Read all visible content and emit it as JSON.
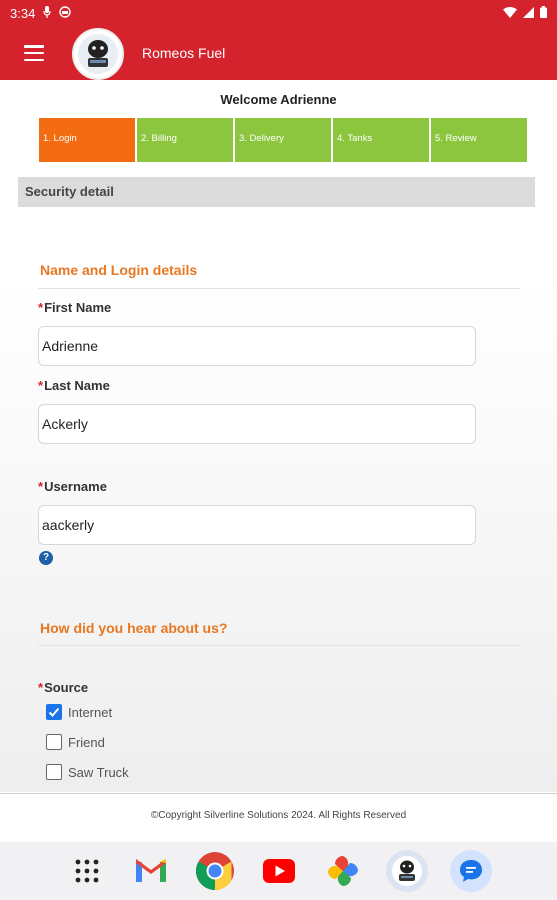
{
  "status_bar": {
    "time": "3:34"
  },
  "app_bar": {
    "title": "Romeos Fuel"
  },
  "welcome": "Welcome Adrienne",
  "steps": [
    {
      "label": "1. Login",
      "active": true
    },
    {
      "label": "2. Billing",
      "active": false
    },
    {
      "label": "3. Delivery",
      "active": false
    },
    {
      "label": "4. Tanks",
      "active": false
    },
    {
      "label": "5. Review",
      "active": false
    }
  ],
  "section_title": "Security detail",
  "login_section": {
    "heading": "Name and Login details",
    "first_name": {
      "label": "First Name",
      "value": "Adrienne"
    },
    "last_name": {
      "label": "Last Name",
      "value": "Ackerly"
    },
    "username": {
      "label": "Username",
      "value": "aackerly"
    },
    "help_symbol": "?"
  },
  "source_section": {
    "heading": "How did you hear about us?",
    "label": "Source",
    "options": [
      {
        "label": "Internet",
        "checked": true
      },
      {
        "label": "Friend",
        "checked": false
      },
      {
        "label": "Saw Truck",
        "checked": false
      }
    ]
  },
  "required_marker": "*",
  "footer": {
    "copyright": "©Copyright Silverline Solutions 2024. All Rights Reserved"
  },
  "dock": [
    "apps-grid-icon",
    "gmail-icon",
    "chrome-icon",
    "youtube-icon",
    "photos-icon",
    "romeos-fuel-app-icon",
    "messages-icon"
  ],
  "colors": {
    "brand_red": "#d4232d",
    "step_active": "#f36c12",
    "step_inactive": "#8cc63e",
    "heading_orange": "#e87722",
    "checkbox_blue": "#1a73e8"
  }
}
